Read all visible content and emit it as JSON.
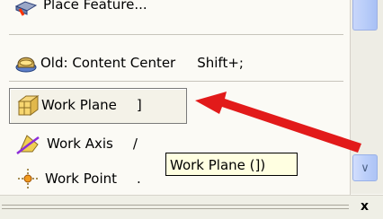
{
  "menu": {
    "items": [
      {
        "label": "Place Feature..."
      },
      {
        "label": "Old: Content Center",
        "shortcut": "Shift+;"
      },
      {
        "label": "Work Plane",
        "shortcut": "]"
      },
      {
        "label": "Work Axis",
        "shortcut": "/"
      },
      {
        "label": "Work Point",
        "shortcut": "."
      }
    ]
  },
  "tooltip": {
    "text": "Work Plane (])"
  },
  "panel": {
    "close_label": "x"
  },
  "colors": {
    "accent_arrow": "#e21a1a",
    "tooltip_bg": "#ffffe1",
    "scroll_blue": "#b9cdf9"
  }
}
